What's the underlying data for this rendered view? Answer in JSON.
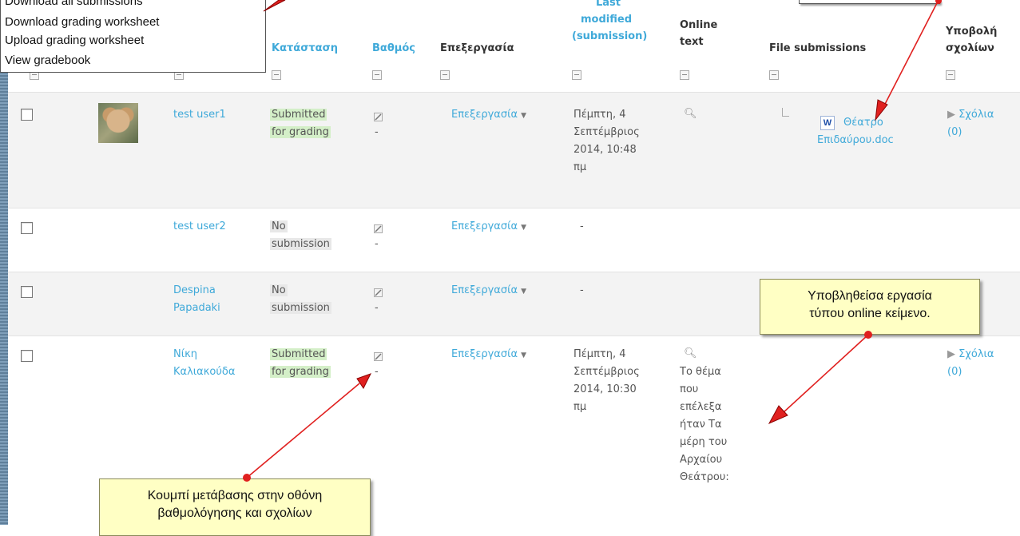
{
  "menu": {
    "items": [
      "Download all submissions",
      "Download grading worksheet",
      "Upload grading worksheet",
      "View gradebook"
    ]
  },
  "headers": {
    "status": "Κατάσταση",
    "grade": "Βαθμός",
    "edit": "Επεξεργασία",
    "last_modified_1": "Last",
    "last_modified_2": "modified",
    "last_modified_3": "(submission)",
    "online_text_1": "Online",
    "online_text_2": "text",
    "file_submissions": "File submissions",
    "feedback_1": "Υποβολή",
    "feedback_2": "σχολίων"
  },
  "rows": [
    {
      "user": "test user1",
      "status_1": "Submitted",
      "status_2": "for grading",
      "grade": "-",
      "edit": "Επεξεργασία",
      "modified": [
        "Πέμπτη, 4",
        "Σεπτέμβριος",
        "2014, 10:48",
        "πμ"
      ],
      "file_1": "Θέατρο",
      "file_2": "Επιδαύρου.doc",
      "comments_1": "Σχόλια",
      "comments_2": "(0)"
    },
    {
      "user": "test user2",
      "status_1": "No",
      "status_2": "submission",
      "grade": "-",
      "edit": "Επεξεργασία",
      "modified": "-"
    },
    {
      "user_1": "Despina",
      "user_2": "Papadaki",
      "status_1": "No",
      "status_2": "submission",
      "grade": "-",
      "edit": "Επεξεργασία",
      "modified": "-"
    },
    {
      "user_1": "Νίκη",
      "user_2": "Καλιακούδα",
      "status_1": "Submitted",
      "status_2": "for grading",
      "grade": "-",
      "edit": "Επεξεργασία",
      "modified": [
        "Πέμπτη, 4",
        "Σεπτέμβριος",
        "2014, 10:30",
        "πμ"
      ],
      "online_text": [
        "Το θέμα",
        "που",
        "επέλεξα",
        "ήταν Τα",
        "μέρη του",
        "Αρχαίου",
        "Θεάτρου:"
      ],
      "comments_1": "Σχόλια",
      "comments_2": "(0)"
    }
  ],
  "callouts": {
    "online_1": "Υποβληθείσα εργασία",
    "online_2": "τύπου online κείμενο.",
    "grade_1": "Κουμπί μετάβασης στην οθόνη",
    "grade_2": "βαθμολόγησης και σχολίων"
  },
  "colors": {
    "link": "#3fa9d9",
    "submitted": "#d4efc8",
    "no_submission": "#e8e8e8",
    "callout": "#ffffc4",
    "arrow": "#e0201f"
  }
}
